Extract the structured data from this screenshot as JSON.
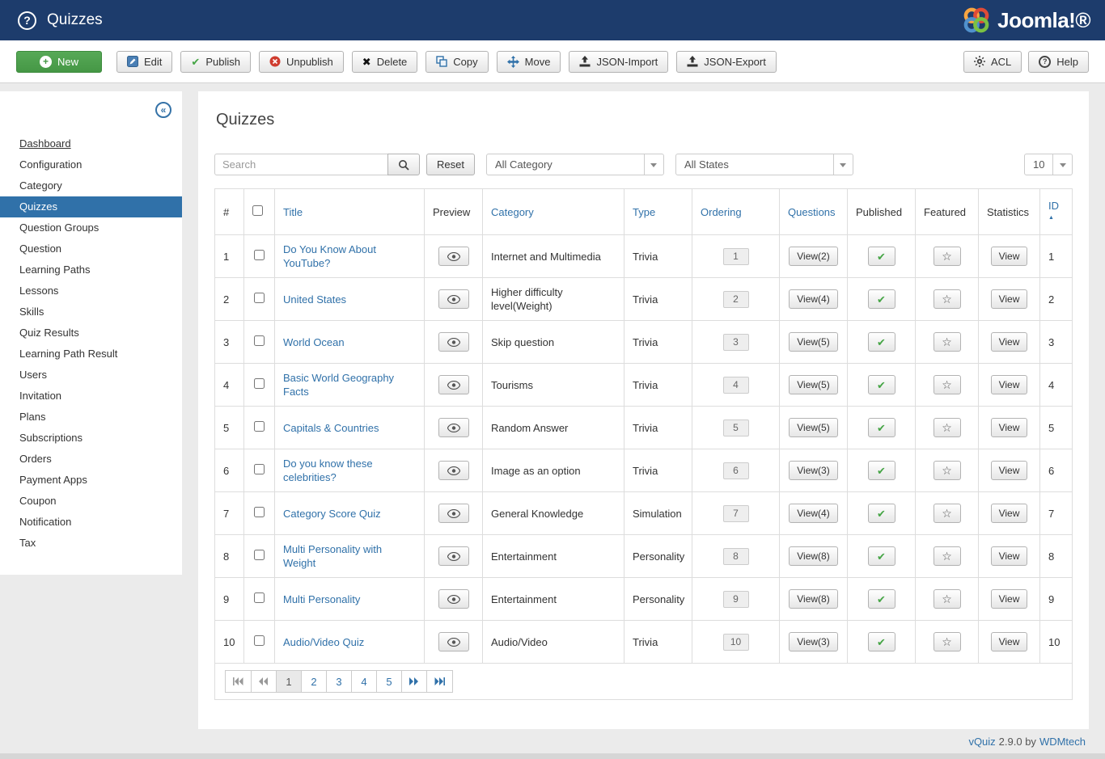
{
  "colors": {
    "topbar": "#1d3c6c",
    "accent": "#3071a9",
    "success": "#46a546"
  },
  "header": {
    "title": "Quizzes",
    "brand": "Joomla!®"
  },
  "toolbar": {
    "new": "New",
    "edit": "Edit",
    "publish": "Publish",
    "unpublish": "Unpublish",
    "delete": "Delete",
    "copy": "Copy",
    "move": "Move",
    "json_import": "JSON-Import",
    "json_export": "JSON-Export",
    "acl": "ACL",
    "help": "Help"
  },
  "sidebar": {
    "items": [
      {
        "label": "Dashboard",
        "active": false
      },
      {
        "label": "Configuration",
        "active": false
      },
      {
        "label": "Category",
        "active": false
      },
      {
        "label": "Quizzes",
        "active": true
      },
      {
        "label": "Question Groups",
        "active": false
      },
      {
        "label": "Question",
        "active": false
      },
      {
        "label": "Learning Paths",
        "active": false
      },
      {
        "label": "Lessons",
        "active": false
      },
      {
        "label": "Skills",
        "active": false
      },
      {
        "label": "Quiz Results",
        "active": false
      },
      {
        "label": "Learning Path Result",
        "active": false
      },
      {
        "label": "Users",
        "active": false
      },
      {
        "label": "Invitation",
        "active": false
      },
      {
        "label": "Plans",
        "active": false
      },
      {
        "label": "Subscriptions",
        "active": false
      },
      {
        "label": "Orders",
        "active": false
      },
      {
        "label": "Payment Apps",
        "active": false
      },
      {
        "label": "Coupon",
        "active": false
      },
      {
        "label": "Notification",
        "active": false
      },
      {
        "label": "Tax",
        "active": false
      }
    ]
  },
  "main": {
    "heading": "Quizzes",
    "filters": {
      "search_placeholder": "Search",
      "reset": "Reset",
      "category": "All Category",
      "states": "All States",
      "page_size": "10"
    },
    "table": {
      "headers": {
        "num": "#",
        "title": "Title",
        "preview": "Preview",
        "category": "Category",
        "type": "Type",
        "ordering": "Ordering",
        "questions": "Questions",
        "published": "Published",
        "featured": "Featured",
        "statistics": "Statistics",
        "id": "ID"
      },
      "rows": [
        {
          "num": "1",
          "title": "Do You Know About YouTube?",
          "category": "Internet and Multimedia",
          "type": "Trivia",
          "ordering": "1",
          "questions": "View(2)",
          "statistics": "View",
          "id": "1"
        },
        {
          "num": "2",
          "title": "United States",
          "category": "Higher difficulty level(Weight)",
          "type": "Trivia",
          "ordering": "2",
          "questions": "View(4)",
          "statistics": "View",
          "id": "2"
        },
        {
          "num": "3",
          "title": "World Ocean",
          "category": "Skip question",
          "type": "Trivia",
          "ordering": "3",
          "questions": "View(5)",
          "statistics": "View",
          "id": "3"
        },
        {
          "num": "4",
          "title": "Basic World Geography Facts",
          "category": "Tourisms",
          "type": "Trivia",
          "ordering": "4",
          "questions": "View(5)",
          "statistics": "View",
          "id": "4"
        },
        {
          "num": "5",
          "title": "Capitals & Countries",
          "category": "Random Answer",
          "type": "Trivia",
          "ordering": "5",
          "questions": "View(5)",
          "statistics": "View",
          "id": "5"
        },
        {
          "num": "6",
          "title": "Do you know these celebrities?",
          "category": "Image as an option",
          "type": "Trivia",
          "ordering": "6",
          "questions": "View(3)",
          "statistics": "View",
          "id": "6"
        },
        {
          "num": "7",
          "title": "Category Score Quiz",
          "category": "General Knowledge",
          "type": "Simulation",
          "ordering": "7",
          "questions": "View(4)",
          "statistics": "View",
          "id": "7"
        },
        {
          "num": "8",
          "title": "Multi Personality with Weight",
          "category": "Entertainment",
          "type": "Personality",
          "ordering": "8",
          "questions": "View(8)",
          "statistics": "View",
          "id": "8"
        },
        {
          "num": "9",
          "title": "Multi Personality",
          "category": "Entertainment",
          "type": "Personality",
          "ordering": "9",
          "questions": "View(8)",
          "statistics": "View",
          "id": "9"
        },
        {
          "num": "10",
          "title": "Audio/Video Quiz",
          "category": "Audio/Video",
          "type": "Trivia",
          "ordering": "10",
          "questions": "View(3)",
          "statistics": "View",
          "id": "10"
        }
      ]
    },
    "pagination": {
      "pages": [
        "1",
        "2",
        "3",
        "4",
        "5"
      ],
      "active": "1"
    }
  },
  "footer": {
    "product": "vQuiz",
    "middle": "2.9.0 by",
    "brand": "WDMtech"
  }
}
